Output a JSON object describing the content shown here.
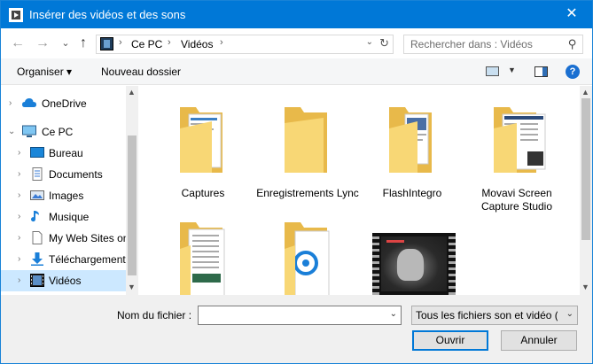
{
  "window": {
    "title": "Insérer des vidéos et des sons",
    "close_glyph": "✕"
  },
  "nav": {
    "back_glyph": "←",
    "forward_glyph": "→",
    "recent_glyph": "⌄",
    "up_glyph": "↑"
  },
  "address": {
    "crumbs": [
      "Ce PC",
      "Vidéos"
    ],
    "separator": "›",
    "dropdown_glyph": "⌄",
    "refresh_glyph": "↻"
  },
  "search": {
    "placeholder": "Rechercher dans : Vidéos",
    "icon": "search-icon",
    "icon_glyph": "⚲"
  },
  "toolbar": {
    "organize_label": "Organiser ▾",
    "new_folder_label": "Nouveau dossier",
    "view_dropdown_glyph": "▼",
    "help_glyph": "?"
  },
  "navpane": {
    "items": [
      {
        "label": "OneDrive",
        "icon": "cloud-icon",
        "arrow": "›"
      },
      {
        "label": "Ce PC",
        "icon": "computer-icon",
        "arrow": "⌄"
      },
      {
        "label": "Bureau",
        "icon": "desktop-icon",
        "arrow": "›"
      },
      {
        "label": "Documents",
        "icon": "documents-icon",
        "arrow": "›"
      },
      {
        "label": "Images",
        "icon": "images-icon",
        "arrow": "›"
      },
      {
        "label": "Musique",
        "icon": "music-icon",
        "arrow": "›"
      },
      {
        "label": "My Web Sites on",
        "icon": "file-icon",
        "arrow": "›"
      },
      {
        "label": "Téléchargement",
        "icon": "download-icon",
        "arrow": "›"
      },
      {
        "label": "Vidéos",
        "icon": "videos-icon",
        "arrow": "›",
        "selected": true
      }
    ],
    "scroll_up": "▲",
    "scroll_down": "▼"
  },
  "content": {
    "items": [
      {
        "label": "Captures",
        "type": "folder"
      },
      {
        "label": "Enregistrements Lync",
        "type": "folder"
      },
      {
        "label": "FlashIntegro",
        "type": "folder"
      },
      {
        "label": "Movavi Screen Capture Studio",
        "type": "folder"
      },
      {
        "label": "",
        "type": "folder"
      },
      {
        "label": "",
        "type": "folder"
      },
      {
        "label": "",
        "type": "video"
      }
    ],
    "scroll_up": "▲",
    "scroll_down": "▼"
  },
  "bottom": {
    "filename_label": "Nom du fichier :",
    "filename_value": "",
    "filename_dropdown_glyph": "⌄",
    "filter_value": "Tous les fichiers son et vidéo (*.",
    "filter_dropdown_glyph": "⌄",
    "open_label": "Ouvrir",
    "cancel_label": "Annuler"
  },
  "colors": {
    "titlebar": "#0078d7",
    "selection": "#cce8ff",
    "folder": "#f8d775"
  }
}
